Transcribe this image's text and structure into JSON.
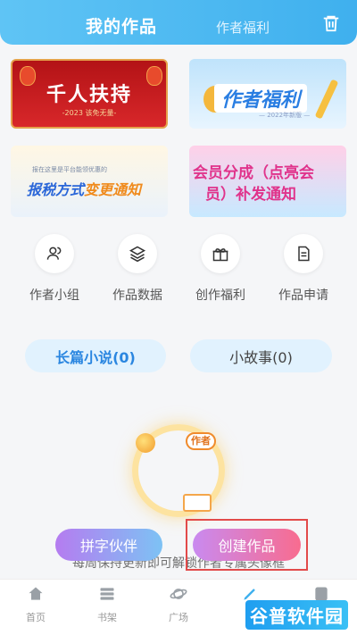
{
  "header": {
    "tab_my_works": "我的作品",
    "tab_author_benefits": "作者福利",
    "trash_icon": "trash-icon"
  },
  "banners": [
    {
      "title": "千人扶持",
      "subtitle": "-2023 该免无量-"
    },
    {
      "title": "作者福利",
      "subtitle": "— 2022年新版 —"
    },
    {
      "small": "报在这里是平台能领优惠的",
      "title_a": "报税方式",
      "title_b": "变更通知"
    },
    {
      "line1": "会员分成（点亮会",
      "line2": "员）补发通知"
    }
  ],
  "quick_actions": [
    {
      "label": "作者小组",
      "icon": "group-icon"
    },
    {
      "label": "作品数据",
      "icon": "layers-icon"
    },
    {
      "label": "创作福利",
      "icon": "gift-icon"
    },
    {
      "label": "作品申请",
      "icon": "document-icon"
    }
  ],
  "categories": {
    "long_novel": "长篇小说(0)",
    "short_story": "小故事(0)"
  },
  "empty_state": {
    "badge": "作者",
    "hint": "每周保持更新即可解锁作者专属头像框"
  },
  "actions": {
    "partner": "拼字伙伴",
    "create": "创建作品"
  },
  "tabbar": [
    {
      "label": "首页",
      "icon": "home-icon"
    },
    {
      "label": "书架",
      "icon": "bookshelf-icon"
    },
    {
      "label": "广场",
      "icon": "planet-icon"
    },
    {
      "label": "",
      "icon": "pen-icon"
    },
    {
      "label": "",
      "icon": "profile-icon"
    }
  ],
  "watermark": "谷普软件园",
  "colors": {
    "header": "#3fb0ee",
    "accent_blue": "#2a86e0",
    "create_pink": "#f86c8f",
    "selection_red": "#e24a4a"
  }
}
